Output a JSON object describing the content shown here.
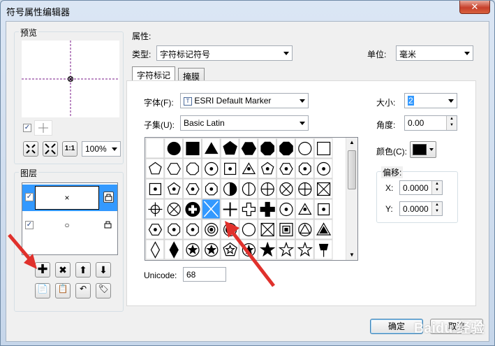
{
  "window": {
    "title": "符号属性编辑器",
    "close_icon": "close-icon"
  },
  "preview": {
    "label": "预览",
    "zoom_value": "100%",
    "zoom_options": [
      "100%"
    ]
  },
  "layers": {
    "label": "图层",
    "items": [
      {
        "symbol": "×",
        "selected": true
      },
      {
        "symbol": "○",
        "selected": false
      }
    ]
  },
  "properties": {
    "label": "属性:",
    "type_label": "类型:",
    "type_value": "字符标记符号",
    "unit_label": "单位:",
    "unit_value": "毫米",
    "tabs": [
      {
        "label": "字符标记",
        "active": true
      },
      {
        "label": "掩膜",
        "active": false
      }
    ],
    "font_label": "字体(F):",
    "font_value": "ESRI Default Marker",
    "subset_label": "子集(U):",
    "subset_value": "Basic Latin",
    "unicode_label": "Unicode:",
    "unicode_value": "68",
    "size_label": "大小:",
    "size_value": "2",
    "angle_label": "角度:",
    "angle_value": "0.00",
    "color_label": "颜色(C):",
    "color_value": "#000000",
    "offset_label": "偏移:",
    "x_label": "X:",
    "x_value": "0.0000",
    "y_label": "Y:",
    "y_value": "0.0000"
  },
  "buttons": {
    "ok": "确定",
    "cancel": "取消"
  },
  "watermark": "Baidu 经验",
  "accent": "#3399ff",
  "arrow_color": "#e0312c"
}
